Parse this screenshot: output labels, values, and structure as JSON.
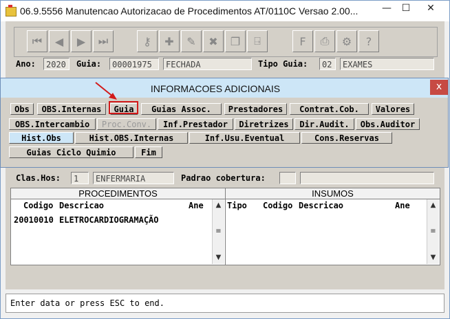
{
  "window": {
    "title": "06.9.5556 Manutencao Autorizacao de Procedimentos AT/0110C Versao 2.00...",
    "min": "—",
    "max": "☐",
    "close": "✕"
  },
  "form": {
    "ano_label": "Ano:",
    "ano": "2020",
    "guia_label": "Guia:",
    "guia": "00001975",
    "guia_status": "FECHADA",
    "tipo_guia_label": "Tipo Guia:",
    "tipo_guia_code": "02",
    "tipo_guia": "EXAMES",
    "clas_hos_label": "Clas.Hos:",
    "clas_hos_code": "1",
    "clas_hos": "ENFERMARIA",
    "padrao_label": "Padrao cobertura:"
  },
  "dialog": {
    "title": "INFORMACOES ADICIONAIS",
    "close": "x",
    "row1": [
      "Obs",
      "OBS.Internas",
      "Guia",
      "Guias Assoc.",
      "Prestadores",
      "Contrat.Cob.",
      "Valores"
    ],
    "row2": [
      "OBS.Intercambio",
      "Proc.Conv.",
      "Inf.Prestador",
      "Diretrizes",
      "Dir.Audit.",
      "Obs.Auditor"
    ],
    "row3": [
      "Hist.Obs",
      "Hist.OBS.Internas",
      "Inf.Usu.Eventual",
      "Cons.Reservas"
    ],
    "row4": [
      "Guias Ciclo Quimio",
      "Fim"
    ]
  },
  "procedimentos": {
    "title": "PROCEDIMENTOS",
    "columns": [
      "Codigo",
      "Descricao",
      "Ane"
    ],
    "rows": [
      {
        "codigo": "20010010",
        "descricao": "ELETROCARDIOGRAMAÇÃO"
      }
    ]
  },
  "insumos": {
    "title": "INSUMOS",
    "columns": [
      "Tipo",
      "Codigo",
      "Descricao",
      "Ane"
    ]
  },
  "status": "Enter data or press ESC to end."
}
